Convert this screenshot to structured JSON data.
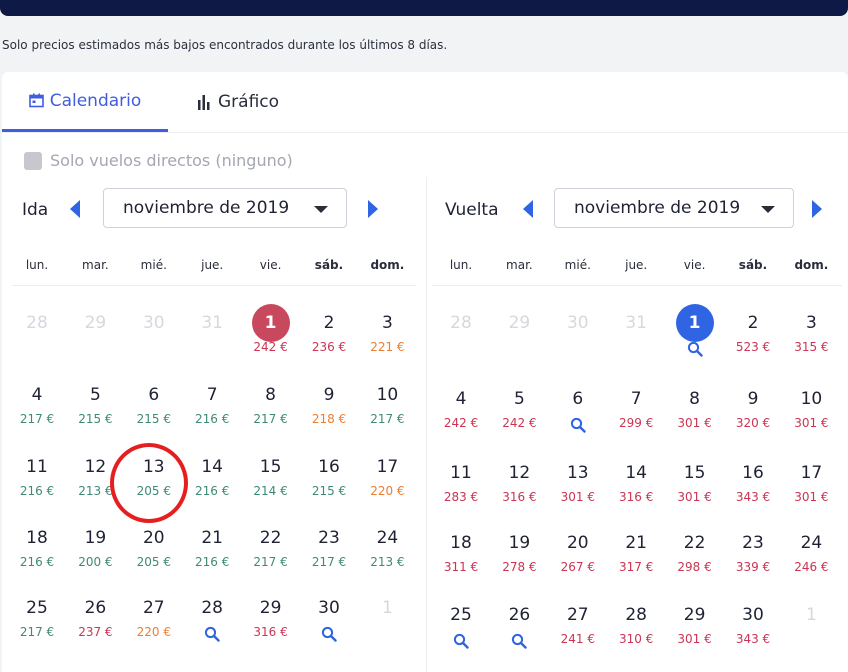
{
  "note": "Solo precios estimados más bajos encontrados durante los últimos 8 días.",
  "tabs": {
    "calendar": "Calendario",
    "chart": "Gráfico"
  },
  "direct_only": "Solo vuelos directos (ninguno)",
  "weekdays": [
    "lun.",
    "mar.",
    "mié.",
    "jue.",
    "vie.",
    "sáb.",
    "dom."
  ],
  "outbound": {
    "label": "Ida",
    "month": "noviembre de 2019",
    "days": [
      {
        "d": "28",
        "p": "",
        "t": "faded"
      },
      {
        "d": "29",
        "p": "",
        "t": "faded"
      },
      {
        "d": "30",
        "p": "",
        "t": "faded"
      },
      {
        "d": "31",
        "p": "",
        "t": "faded"
      },
      {
        "d": "1",
        "p": "242 €",
        "c": "red",
        "t": "sel-red"
      },
      {
        "d": "2",
        "p": "236 €",
        "c": "red"
      },
      {
        "d": "3",
        "p": "221 €",
        "c": "orange"
      },
      {
        "d": "4",
        "p": "217 €",
        "c": "green"
      },
      {
        "d": "5",
        "p": "215 €",
        "c": "green"
      },
      {
        "d": "6",
        "p": "215 €",
        "c": "green"
      },
      {
        "d": "7",
        "p": "216 €",
        "c": "green"
      },
      {
        "d": "8",
        "p": "217 €",
        "c": "green"
      },
      {
        "d": "9",
        "p": "218 €",
        "c": "orange"
      },
      {
        "d": "10",
        "p": "217 €",
        "c": "green"
      },
      {
        "d": "11",
        "p": "216 €",
        "c": "green"
      },
      {
        "d": "12",
        "p": "213 €",
        "c": "green"
      },
      {
        "d": "13",
        "p": "205 €",
        "c": "green"
      },
      {
        "d": "14",
        "p": "216 €",
        "c": "green"
      },
      {
        "d": "15",
        "p": "214 €",
        "c": "green"
      },
      {
        "d": "16",
        "p": "215 €",
        "c": "green"
      },
      {
        "d": "17",
        "p": "220 €",
        "c": "orange"
      },
      {
        "d": "18",
        "p": "216 €",
        "c": "green"
      },
      {
        "d": "19",
        "p": "200 €",
        "c": "green"
      },
      {
        "d": "20",
        "p": "205 €",
        "c": "green"
      },
      {
        "d": "21",
        "p": "216 €",
        "c": "green"
      },
      {
        "d": "22",
        "p": "217 €",
        "c": "green"
      },
      {
        "d": "23",
        "p": "217 €",
        "c": "green"
      },
      {
        "d": "24",
        "p": "213 €",
        "c": "green"
      },
      {
        "d": "25",
        "p": "217 €",
        "c": "green"
      },
      {
        "d": "26",
        "p": "237 €",
        "c": "red"
      },
      {
        "d": "27",
        "p": "220 €",
        "c": "orange"
      },
      {
        "d": "28",
        "p": "",
        "s": true
      },
      {
        "d": "29",
        "p": "316 €",
        "c": "red"
      },
      {
        "d": "30",
        "p": "",
        "s": true
      },
      {
        "d": "1",
        "p": "",
        "t": "faded"
      }
    ]
  },
  "return": {
    "label": "Vuelta",
    "month": "noviembre de 2019",
    "days": [
      {
        "d": "28",
        "p": "",
        "t": "faded"
      },
      {
        "d": "29",
        "p": "",
        "t": "faded"
      },
      {
        "d": "30",
        "p": "",
        "t": "faded"
      },
      {
        "d": "31",
        "p": "",
        "t": "faded"
      },
      {
        "d": "1",
        "p": "",
        "s": true,
        "t": "sel-blue"
      },
      {
        "d": "2",
        "p": "523 €",
        "c": "red"
      },
      {
        "d": "3",
        "p": "315 €",
        "c": "red"
      },
      {
        "d": "4",
        "p": "242 €",
        "c": "red"
      },
      {
        "d": "5",
        "p": "242 €",
        "c": "red"
      },
      {
        "d": "6",
        "p": "",
        "s": true
      },
      {
        "d": "7",
        "p": "299 €",
        "c": "red"
      },
      {
        "d": "8",
        "p": "301 €",
        "c": "red"
      },
      {
        "d": "9",
        "p": "320 €",
        "c": "red"
      },
      {
        "d": "10",
        "p": "301 €",
        "c": "red"
      },
      {
        "d": "11",
        "p": "283 €",
        "c": "red"
      },
      {
        "d": "12",
        "p": "316 €",
        "c": "red"
      },
      {
        "d": "13",
        "p": "301 €",
        "c": "red"
      },
      {
        "d": "14",
        "p": "316 €",
        "c": "red"
      },
      {
        "d": "15",
        "p": "301 €",
        "c": "red"
      },
      {
        "d": "16",
        "p": "343 €",
        "c": "red"
      },
      {
        "d": "17",
        "p": "301 €",
        "c": "red"
      },
      {
        "d": "18",
        "p": "311 €",
        "c": "red"
      },
      {
        "d": "19",
        "p": "278 €",
        "c": "red"
      },
      {
        "d": "20",
        "p": "267 €",
        "c": "red"
      },
      {
        "d": "21",
        "p": "317 €",
        "c": "red"
      },
      {
        "d": "22",
        "p": "298 €",
        "c": "red"
      },
      {
        "d": "23",
        "p": "339 €",
        "c": "red"
      },
      {
        "d": "24",
        "p": "246 €",
        "c": "red"
      },
      {
        "d": "25",
        "p": "",
        "s": true
      },
      {
        "d": "26",
        "p": "",
        "s": true
      },
      {
        "d": "27",
        "p": "241 €",
        "c": "red"
      },
      {
        "d": "28",
        "p": "310 €",
        "c": "red"
      },
      {
        "d": "29",
        "p": "301 €",
        "c": "red"
      },
      {
        "d": "30",
        "p": "343 €",
        "c": "red"
      },
      {
        "d": "1",
        "p": "",
        "t": "faded"
      }
    ]
  },
  "colors": {
    "accent": "#3f5de0",
    "price_low": "#3f8a76",
    "price_high": "#cc3452",
    "price_mid": "#ee7d30",
    "highlight_ring": "#e51f1f"
  },
  "icons": {
    "calendar_tab": "calendar-icon",
    "chart_tab": "bar-chart-icon",
    "no_price": "search-icon"
  }
}
